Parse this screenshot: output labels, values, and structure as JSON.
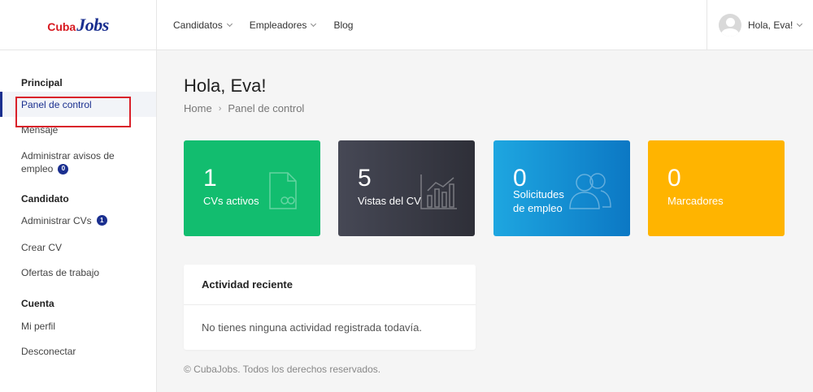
{
  "header": {
    "logo": {
      "part1": "Cuba",
      "part2": "Jobs"
    },
    "nav": [
      {
        "label": "Candidatos"
      },
      {
        "label": "Empleadores"
      },
      {
        "label": "Blog"
      }
    ],
    "user_label": "Hola, Eva!"
  },
  "sidebar": {
    "sections": [
      {
        "title": "Principal"
      },
      {
        "title": "Candidato"
      },
      {
        "title": "Cuenta"
      }
    ],
    "items": [
      {
        "label": "Panel de control"
      },
      {
        "label": "Mensaje"
      },
      {
        "label_line1": "Administrar avisos de",
        "label_line2": "empleo",
        "badge": "0"
      },
      {
        "label": "Administrar CVs",
        "badge": "1"
      },
      {
        "label": "Crear CV"
      },
      {
        "label": "Ofertas de trabajo"
      },
      {
        "label": "Mi perfil"
      },
      {
        "label": "Desconectar"
      }
    ]
  },
  "main": {
    "title": "Hola, Eva!",
    "breadcrumb": {
      "home": "Home",
      "separator": "›",
      "current": "Panel de control"
    },
    "cards": [
      {
        "value": "1",
        "label_line1": "CVs activos",
        "color": "#12bd6f",
        "icon": "document-link-icon"
      },
      {
        "value": "5",
        "label_line1": "Vistas del CV",
        "color": "#3a3b45",
        "icon": "bar-chart-icon"
      },
      {
        "value": "0",
        "label_line1": "Solicitudes",
        "label_line2": "de empleo",
        "color": "#1092d6",
        "icon": "users-icon"
      },
      {
        "value": "0",
        "label_line1": "Marcadores",
        "color": "#ffb400",
        "icon": ""
      }
    ],
    "activity": {
      "title": "Actividad reciente",
      "empty_text": "No tienes ninguna actividad registrada todavía."
    },
    "footer": "© CubaJobs. Todos los derechos reservados."
  },
  "colors": {
    "brand_blue": "#1a2f8f",
    "brand_red": "#d71920",
    "highlight": "#d9202a"
  }
}
